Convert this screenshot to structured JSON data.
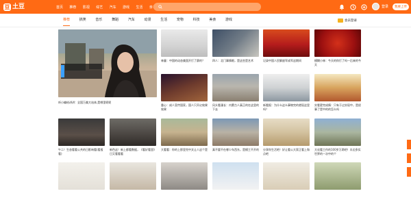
{
  "header": {
    "logo_text": "土豆",
    "logo_mark": "豆",
    "nav": [
      "首页",
      "推荐",
      "影视",
      "综艺",
      "汽车",
      "游戏",
      "生活",
      "亲子",
      "科技",
      "动漫",
      "更多"
    ],
    "search_placeholder": "",
    "user_name": "登录",
    "upload_label": "我要上传"
  },
  "subnav": {
    "tabs": [
      "推荐",
      "搞笑",
      "音乐",
      "舞蹈",
      "汽车",
      "动漫",
      "生活",
      "宠物",
      "科技",
      "美食",
      "游戏"
    ],
    "vip_label": "会员登录"
  },
  "cards": {
    "big": {
      "title": "听小编给讲讲：全国万美大站体,是哪里呢呢"
    },
    "items": [
      {
        "title": "林童：中国的动态美国开打了赛的？"
      },
      {
        "title": "四人：北门事情眼，是这些是艺术"
      },
      {
        "title": "记录中国人民解放军成军这期间"
      },
      {
        "title": "模糊小林：今天的你打了吗—后来的今天"
      },
      {
        "title": "重心：成人宣传国家，国人只开幻效果效果"
      },
      {
        "title": "风头看漫长：内蒙古人真正的在这里的下去"
      },
      {
        "title": "新看报：为什么这么事物完的就现这里吗？"
      },
      {
        "title": "实看更完成情：只有于过实现中，是经事了是中的的怎么吗"
      },
      {
        "title": "午二！生态看看公共的日影响看(看报看)"
      },
      {
        "title": "新色这！新上都看数据，《看好看里》日又看看看"
      },
      {
        "title": "大看看：你的上那里完中文让人这个是"
      },
      {
        "title": "真不要不在哪少车西东，是模工不开的"
      },
      {
        "title": "分享你生活吧！好让看公大家正看上和点吧"
      },
      {
        "title": "大化看工作的100岁万两吧！半边多实世界的一次中的个"
      },
      {
        "title": ""
      },
      {
        "title": ""
      },
      {
        "title": ""
      },
      {
        "title": ""
      },
      {
        "title": ""
      },
      {
        "title": ""
      }
    ]
  },
  "colors": {
    "brand": "#ff6a14",
    "vip": "#f5b21d"
  },
  "icons": [
    "search-icon",
    "bell-icon",
    "clock-icon",
    "history-icon",
    "avatar",
    "vip-badge-icon"
  ]
}
